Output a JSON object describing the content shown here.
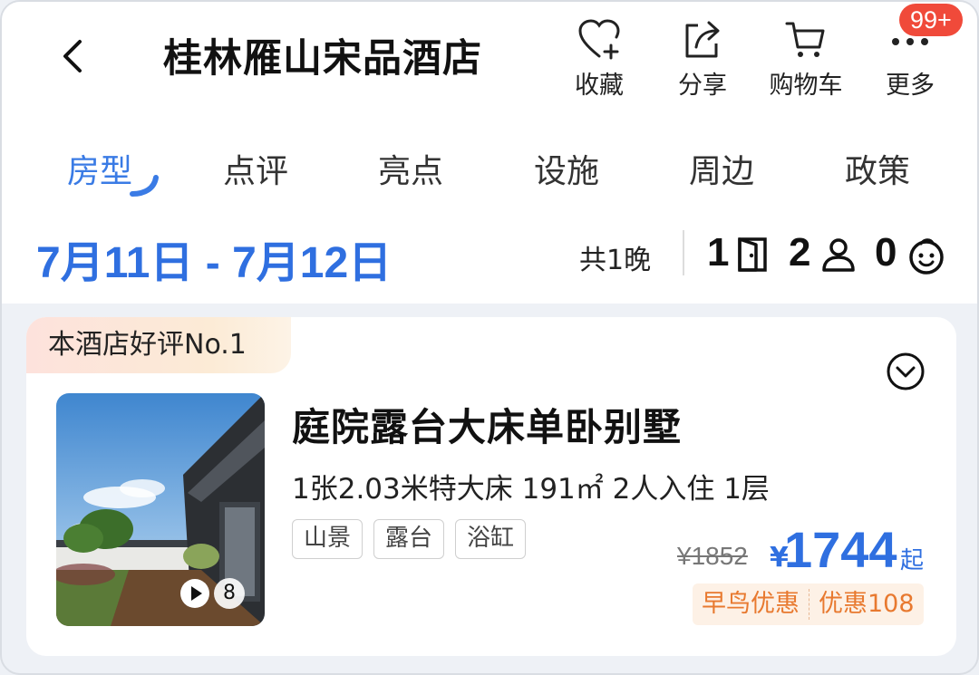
{
  "header": {
    "title": "桂林雁山宋品酒店",
    "actions": [
      {
        "label": "收藏",
        "icon": "heart-plus-icon"
      },
      {
        "label": "分享",
        "icon": "share-icon"
      },
      {
        "label": "购物车",
        "icon": "cart-icon"
      },
      {
        "label": "更多",
        "icon": "more-icon"
      }
    ],
    "badge": "99+"
  },
  "tabs": [
    {
      "label": "房型",
      "active": true
    },
    {
      "label": "点评",
      "active": false
    },
    {
      "label": "亮点",
      "active": false
    },
    {
      "label": "设施",
      "active": false
    },
    {
      "label": "周边",
      "active": false
    },
    {
      "label": "政策",
      "active": false
    }
  ],
  "booking": {
    "date_range": "7月11日 - 7月12日",
    "nights": "共1晚",
    "rooms": "1",
    "adults": "2",
    "children": "0"
  },
  "room_card": {
    "rank_badge": "本酒店好评No.1",
    "name": "庭院露台大床单卧别墅",
    "specs": "1张2.03米特大床  191㎡  2人入住  1层",
    "tags": [
      "山景",
      "露台",
      "浴缸"
    ],
    "photo_count": "8",
    "original_price": "¥1852",
    "currency": "¥",
    "price": "1744",
    "price_suffix": "起",
    "promos": [
      "早鸟优惠",
      "优惠108"
    ]
  },
  "colors": {
    "accent": "#2f6fe0",
    "badge": "#f04a3a",
    "promo": "#e8792f"
  }
}
